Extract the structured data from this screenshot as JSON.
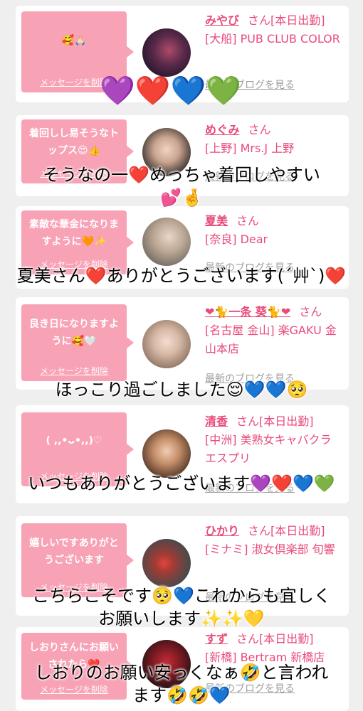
{
  "cards": [
    {
      "bubble": "🥰🙏🏻",
      "delete": "メッセージを削除",
      "name": "みやび",
      "san": "さん[本日出勤]",
      "shop": "[大船] PUB CLUB COLOR",
      "blog": "最新のブログを見る"
    },
    {
      "bubble": "着回しし易そうなトップス😍👍",
      "delete": "メッセージを削除",
      "name": "めぐみ",
      "san": "さん",
      "shop": "[上野] Mrs.J 上野",
      "blog": "最新のブログを見る"
    },
    {
      "bubble": "素敵な華金になりますように🧡✨",
      "delete": "メッセージを削除",
      "name": "夏美",
      "san": "さん",
      "shop": "[奈良] Dear",
      "blog": "最新のブログを見る"
    },
    {
      "bubble": "良き日になりますように🥰🤍",
      "delete": "メッセージを削除",
      "name": "❤🐈一条 葵🐈❤",
      "san": "さん",
      "shop": "[名古屋 金山] 楽GAKU 金山本店",
      "blog": "最新のブログを見る"
    },
    {
      "bubble": "( ,,•ᴗ•,,)♡",
      "delete": "メッセージを削除",
      "name": "清香",
      "san": "さん[本日出勤]",
      "shop": "[中洲] 美熟女キャバクラ エスプリ",
      "blog": "最新のブログを見る"
    },
    {
      "bubble": "嬉しいですありがとうございます",
      "delete": "メッセージを削除",
      "name": "ひかり",
      "san": "さん[本日出勤]",
      "shop": "[ミナミ] 淑女倶楽部 旬響",
      "blog": "最新のブログを見る"
    },
    {
      "bubble": "しおりさんにお願いされたら❤️",
      "delete": "メッセージを削除",
      "name": "すず",
      "san": "さん[本日出勤]",
      "shop": "[新橋] Bertram 新橋店",
      "blog": "最新のブログを見る"
    }
  ],
  "hearts_top": "💜❤️💙💚",
  "overlays": [
    "そうなの一❤️めっちゃ着回しやすい\n💕🤞",
    "夏美さん❤️ありがとうございます(´艸`)❤️",
    "ほっこり過ごしました😌💙💙🥺",
    "いつもありがとうございます💜❤️💙💚",
    "こちらこそです🥺💙これからも宜しく\nお願いします✨✨💛",
    "しおりのお願い安っくなぁ🤣と言われ\nます🤣🤣💙"
  ],
  "colors": {
    "bubble": "#f8a2b6",
    "accent": "#e94b7a",
    "background": "#efefef"
  }
}
